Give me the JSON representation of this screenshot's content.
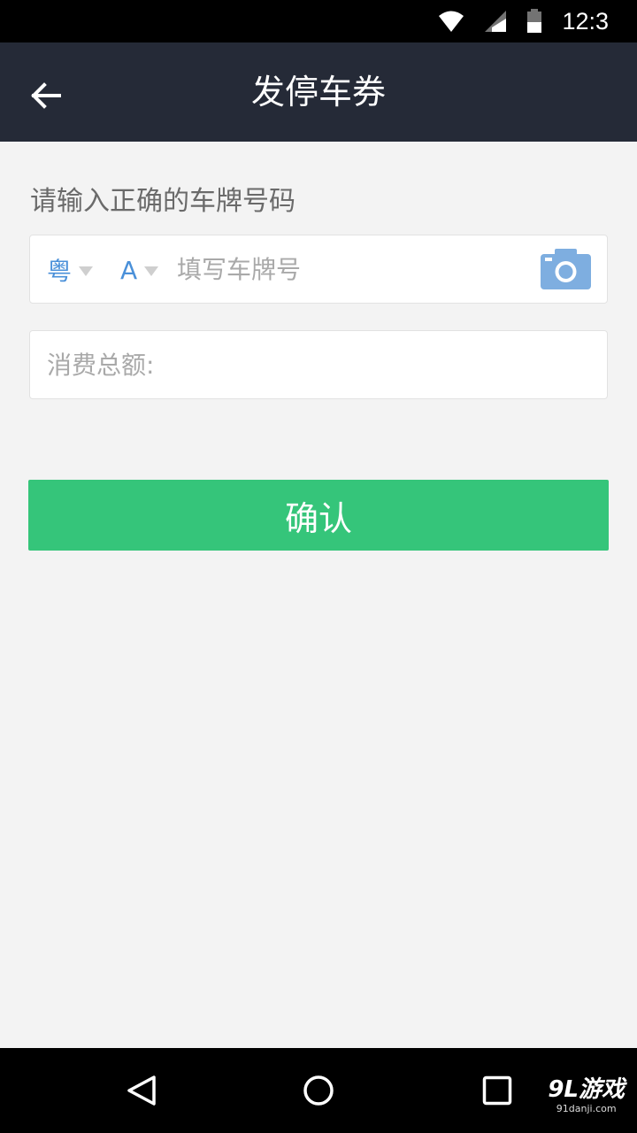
{
  "status_bar": {
    "time": "12:3",
    "icons": [
      "wifi-icon",
      "cell-signal-icon",
      "battery-icon"
    ]
  },
  "app_bar": {
    "title": "发停车券",
    "back_icon": "arrow-left-icon"
  },
  "form": {
    "prompt": "请输入正确的车牌号码",
    "province": "粤",
    "letter": "A",
    "plate_placeholder": "填写车牌号",
    "plate_value": "",
    "camera_icon": "camera-icon",
    "amount_placeholder": "消费总额:",
    "amount_value": ""
  },
  "confirm_button": {
    "label": "确认"
  },
  "nav_bar": {
    "icons": [
      "back-triangle-icon",
      "home-circle-icon",
      "recents-square-icon"
    ]
  },
  "watermark": {
    "main": "9L游戏",
    "sub": "91danji.com"
  },
  "colors": {
    "app_bar": "#252a37",
    "accent_blue": "#4a90d9",
    "confirm_green": "#35c57a",
    "background": "#f3f3f3"
  }
}
